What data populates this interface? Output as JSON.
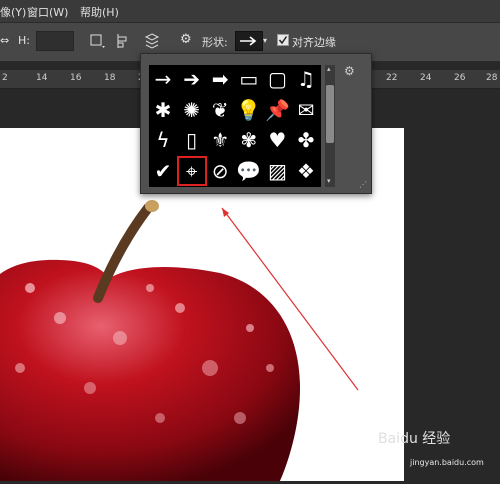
{
  "menu": [
    "像(Y)",
    "窗口(W)",
    "帮助(H)"
  ],
  "options": {
    "h_label": "H:",
    "shape_label": "形状:",
    "align_label": "对齐边缘",
    "align_checked": true
  },
  "ruler": [
    "2",
    "14",
    "16",
    "18",
    "20",
    "22",
    "24",
    "26",
    "28"
  ],
  "shape_picker": {
    "rows": [
      [
        "→",
        "➔",
        "➡",
        "▭",
        "▢",
        "♫"
      ],
      [
        "✱",
        "✺",
        "❦",
        "💡",
        "📌",
        "✉"
      ],
      [
        "ϟ",
        "▯",
        "⚜",
        "✾",
        "♥",
        "✤"
      ],
      [
        "✔",
        "⌖",
        "⊘",
        "💬",
        "▨",
        "❖"
      ]
    ],
    "selected_index": 19
  },
  "watermark": {
    "brand": "Baidu 经验",
    "url": "jingyan.baidu.com"
  },
  "colors": {
    "selection": "#dd2222",
    "arrow": "#e03030"
  }
}
